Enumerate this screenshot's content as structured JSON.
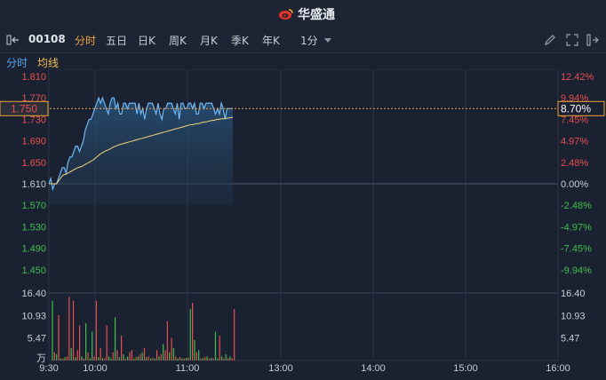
{
  "app": {
    "title": "华盛通"
  },
  "toolbar": {
    "code": "00108",
    "periods": [
      "分时",
      "五日",
      "日K",
      "周K",
      "月K",
      "季K",
      "年K"
    ],
    "active_period": "分时",
    "interval": "1分",
    "icons": [
      "pen-icon",
      "expand-icon",
      "settings-icon"
    ]
  },
  "subtabs": {
    "time": "分时",
    "avg": "均线"
  },
  "colors": {
    "price_line": "#6fb8f5",
    "avg_line": "#f2d27a",
    "up": "#e85050",
    "down": "#3fbf4f",
    "axis_text_neutral": "#c8cdd6",
    "grid": "#2b3446",
    "cursor": "#f0a33a"
  },
  "price_axis": {
    "left_labels": [
      "1.810",
      "1.770",
      "1.730",
      "1.690",
      "1.650",
      "1.610",
      "1.570",
      "1.530",
      "1.490",
      "1.450"
    ],
    "right_labels": [
      "12.42%",
      "9.94%",
      "7.45%",
      "4.97%",
      "2.48%",
      "0.00%",
      "-2.48%",
      "-4.97%",
      "-7.45%",
      "-9.94%"
    ],
    "prev_close": 1.61,
    "range": [
      1.45,
      1.81
    ]
  },
  "cursor": {
    "price": "1.750",
    "pct": "8.70%"
  },
  "volume_axis": {
    "labels": [
      "16.40",
      "10.93",
      "5.47"
    ],
    "unit": "万"
  },
  "time_axis": {
    "labels": [
      "9:30",
      "10:00",
      "11:00",
      "13:00",
      "14:00",
      "15:00",
      "16:00"
    ]
  },
  "chart_data": {
    "type": "line",
    "x_range": [
      "9:30",
      "16:00"
    ],
    "series": [
      {
        "role": "price",
        "values": [
          1.61,
          1.62,
          1.6,
          1.61,
          1.61,
          1.62,
          1.63,
          1.64,
          1.64,
          1.63,
          1.65,
          1.66,
          1.66,
          1.67,
          1.68,
          1.68,
          1.67,
          1.68,
          1.69,
          1.71,
          1.72,
          1.73,
          1.73,
          1.74,
          1.75,
          1.76,
          1.77,
          1.76,
          1.77,
          1.76,
          1.75,
          1.74,
          1.76,
          1.77,
          1.77,
          1.75,
          1.76,
          1.74,
          1.74,
          1.76,
          1.76,
          1.75,
          1.76,
          1.76,
          1.76,
          1.76,
          1.74,
          1.76,
          1.74,
          1.75,
          1.73,
          1.75,
          1.76,
          1.76,
          1.76,
          1.75,
          1.74,
          1.76,
          1.74,
          1.73,
          1.75,
          1.75,
          1.76,
          1.76,
          1.76,
          1.75,
          1.74,
          1.76,
          1.73,
          1.76,
          1.76,
          1.75,
          1.75,
          1.76,
          1.76,
          1.75,
          1.76,
          1.74,
          1.74,
          1.76,
          1.76,
          1.75,
          1.76,
          1.76,
          1.76,
          1.76,
          1.75,
          1.74,
          1.75,
          1.74,
          1.76,
          1.75,
          1.73,
          1.75,
          1.75,
          1.75,
          1.75
        ]
      },
      {
        "role": "average",
        "values": [
          1.61,
          1.61,
          1.61,
          1.61,
          1.61,
          1.615,
          1.62,
          1.625,
          1.627,
          1.628,
          1.63,
          1.632,
          1.634,
          1.636,
          1.638,
          1.64,
          1.641,
          1.642,
          1.644,
          1.646,
          1.648,
          1.65,
          1.652,
          1.654,
          1.657,
          1.66,
          1.663,
          1.666,
          1.668,
          1.67,
          1.672,
          1.673,
          1.675,
          1.677,
          1.679,
          1.68,
          1.682,
          1.683,
          1.684,
          1.685,
          1.686,
          1.687,
          1.688,
          1.689,
          1.69,
          1.691,
          1.692,
          1.693,
          1.694,
          1.695,
          1.696,
          1.697,
          1.698,
          1.699,
          1.7,
          1.701,
          1.702,
          1.703,
          1.704,
          1.705,
          1.706,
          1.707,
          1.708,
          1.709,
          1.71,
          1.711,
          1.712,
          1.713,
          1.714,
          1.715,
          1.716,
          1.717,
          1.718,
          1.719,
          1.72,
          1.72,
          1.721,
          1.722,
          1.722,
          1.723,
          1.724,
          1.725,
          1.725,
          1.726,
          1.727,
          1.728,
          1.728,
          1.729,
          1.73,
          1.73,
          1.731,
          1.731,
          1.732,
          1.732,
          1.733,
          1.733,
          1.734
        ]
      }
    ],
    "volume": [
      14.5,
      2.0,
      1.5,
      11.0,
      0.5,
      0.5,
      0.8,
      1.0,
      15.5,
      3.0,
      14.5,
      0.8,
      2.5,
      8.5,
      1.0,
      0.5,
      9.0,
      2.0,
      0.5,
      7.0,
      1.0,
      14.5,
      0.8,
      3.0,
      0.6,
      0.5,
      8.5,
      1.0,
      0.5,
      2.0,
      10.5,
      2.5,
      0.8,
      6.0,
      1.5,
      0.5,
      1.0,
      2.0,
      2.5,
      0.5,
      0.8,
      1.0,
      1.5,
      2.0,
      3.0,
      0.8,
      1.0,
      0.5,
      0.7,
      0.5,
      2.5,
      1.0,
      1.5,
      4.0,
      2.5,
      9.5,
      2.0,
      5.5,
      3.0,
      1.0,
      0.5,
      0.8,
      0.5,
      0.5,
      0.6,
      0.7,
      12.5,
      14.0,
      5.0,
      2.0,
      2.5,
      0.5,
      0.6,
      0.8,
      1.0,
      0.5,
      0.6,
      0.5,
      7.0,
      0.5,
      6.0,
      1.0,
      0.5,
      1.5,
      0.6,
      1.0,
      0.5,
      12.5
    ],
    "volume_up": [
      false,
      true,
      false,
      true,
      false,
      true,
      false,
      true,
      true,
      false,
      true,
      false,
      true,
      true,
      false,
      true,
      false,
      true,
      false,
      false,
      true,
      true,
      false,
      true,
      false,
      true,
      true,
      false,
      false,
      true,
      false,
      true,
      false,
      true,
      false,
      true,
      false,
      true,
      true,
      false,
      true,
      false,
      true,
      false,
      true,
      false,
      true,
      false,
      true,
      false,
      true,
      false,
      true,
      false,
      true,
      true,
      false,
      true,
      false,
      true,
      false,
      true,
      false,
      true,
      false,
      true,
      false,
      true,
      false,
      true,
      false,
      true,
      false,
      true,
      false,
      true,
      false,
      true,
      false,
      false,
      true,
      false,
      true,
      false,
      true,
      false,
      true,
      true
    ]
  }
}
